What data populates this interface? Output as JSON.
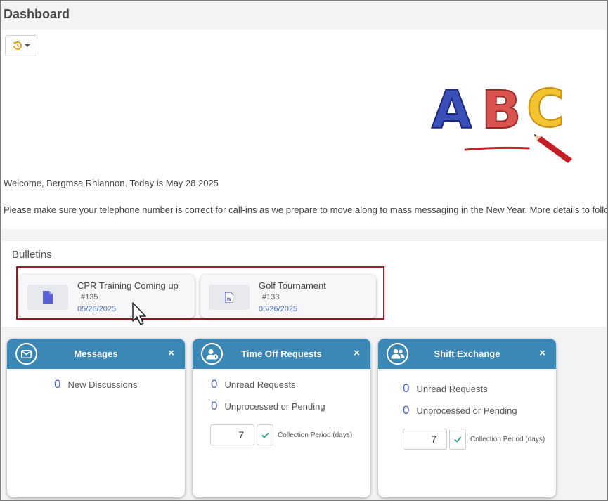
{
  "page": {
    "title": "Dashboard"
  },
  "toolbar": {
    "history_icon": "history-icon"
  },
  "welcome": {
    "logo_text": "ABC",
    "greeting": "Welcome, Bergmsa Rhiannon. Today is May 28 2025",
    "notice": "Please make sure your telephone number is correct for call-ins as we prepare to move along to mass messaging in the New Year. More details to follow."
  },
  "bulletins": {
    "title": "Bulletins",
    "items": [
      {
        "title": "CPR Training Coming up",
        "number": "#135",
        "date": "05/26/2025",
        "icon": "document-icon"
      },
      {
        "title": "Golf Tournament",
        "number": "#133",
        "date": "05/26/2025",
        "icon": "word-document-icon"
      }
    ]
  },
  "widgets": {
    "messages": {
      "title": "Messages",
      "close": "×",
      "icon": "envelope-icon",
      "stats": [
        {
          "value": "0",
          "label": "New Discussions"
        }
      ]
    },
    "time_off": {
      "title": "Time Off Requests",
      "close": "×",
      "icon": "user-clock-icon",
      "stats": [
        {
          "value": "0",
          "label": "Unread Requests"
        },
        {
          "value": "0",
          "label": "Unprocessed or Pending"
        }
      ],
      "period_value": "7",
      "period_label": "Collection Period (days)"
    },
    "shift_exchange": {
      "title": "Shift Exchange",
      "close": "×",
      "icon": "users-icon",
      "stats": [
        {
          "value": "0",
          "label": "Unread Requests"
        },
        {
          "value": "0",
          "label": "Unprocessed or Pending"
        }
      ],
      "period_value": "7",
      "period_label": "Collection Period (days)"
    }
  },
  "colors": {
    "header_blue": "#3b87b5",
    "count_blue": "#4a67c8",
    "highlight_red": "#a51d24",
    "doc_purple": "#5b5fd6"
  }
}
